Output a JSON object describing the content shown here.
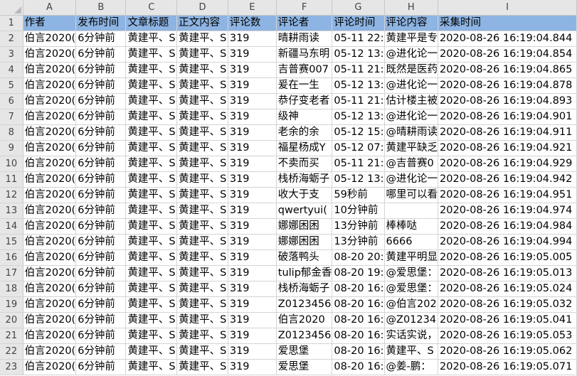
{
  "column_letters": [
    "A",
    "B",
    "C",
    "D",
    "E",
    "F",
    "G",
    "H",
    "I"
  ],
  "header_fill": "#8db4e2",
  "header": [
    "作者",
    "发布时间",
    "文章标题",
    "正文内容",
    "评论数",
    "评论者",
    "评论时间",
    "评论内容",
    "采集时间"
  ],
  "rows": [
    {
      "n": "2",
      "cells": [
        "伯言2020(",
        "6分钟前",
        "黄建平、S",
        "黄建平、S",
        "319",
        "晴耕雨读",
        "05-11 22:",
        "黄建平是专",
        "2020-08-26 16:19:04.844"
      ]
    },
    {
      "n": "3",
      "cells": [
        "伯言2020(",
        "6分钟前",
        "黄建平、S",
        "黄建平、S",
        "319",
        "新疆马东明",
        "05-12 13:",
        "@进化论一",
        "2020-08-26 16:19:04.854"
      ]
    },
    {
      "n": "4",
      "cells": [
        "伯言2020(",
        "6分钟前",
        "黄建平、S",
        "黄建平、S",
        "319",
        "吉普赛007",
        "05-11 21:",
        "既然是医药",
        "2020-08-26 16:19:04.865"
      ]
    },
    {
      "n": "5",
      "cells": [
        "伯言2020(",
        "6分钟前",
        "黄建平、S",
        "黄建平、S",
        "319",
        "爰在一生",
        "05-12 13:",
        "@进化论一",
        "2020-08-26 16:19:04.878"
      ]
    },
    {
      "n": "6",
      "cells": [
        "伯言2020(",
        "6分钟前",
        "黄建平、S",
        "黄建平、S",
        "319",
        "恭仔变老者",
        "05-11 21:",
        "估计楼主被",
        "2020-08-26 16:19:04.893"
      ]
    },
    {
      "n": "7",
      "cells": [
        "伯言2020(",
        "6分钟前",
        "黄建平、S",
        "黄建平、S",
        "319",
        "级神",
        "05-12 13:",
        "@进化论一",
        "2020-08-26 16:19:04.901"
      ]
    },
    {
      "n": "8",
      "cells": [
        "伯言2020(",
        "6分钟前",
        "黄建平、S",
        "黄建平、S",
        "319",
        "老余的余",
        "05-12 15:",
        "@晴耕雨读",
        "2020-08-26 16:19:04.911"
      ]
    },
    {
      "n": "9",
      "cells": [
        "伯言2020(",
        "6分钟前",
        "黄建平、S",
        "黄建平、S",
        "319",
        "福星杨成Y",
        "05-12 07:",
        "黄建平缺乏",
        "2020-08-26 16:19:04.921"
      ]
    },
    {
      "n": "10",
      "cells": [
        "伯言2020(",
        "6分钟前",
        "黄建平、S",
        "黄建平、S",
        "319",
        "不卖而买",
        "05-11 21:",
        "@吉普赛0",
        "2020-08-26 16:19:04.929"
      ]
    },
    {
      "n": "11",
      "cells": [
        "伯言2020(",
        "6分钟前",
        "黄建平、S",
        "黄建平、S",
        "319",
        "栈桥海蛎子",
        "05-12 13:",
        "@进化论一",
        "2020-08-26 16:19:04.942"
      ]
    },
    {
      "n": "12",
      "cells": [
        "伯言2020(",
        "6分钟前",
        "黄建平、S",
        "黄建平、S",
        "319",
        "收大于支",
        "59秒前",
        "哪里可以看",
        "2020-08-26 16:19:04.951"
      ]
    },
    {
      "n": "13",
      "cells": [
        "伯言2020(",
        "6分钟前",
        "黄建平、S",
        "黄建平、S",
        "319",
        "qwertyui(",
        "10分钟前",
        "",
        "2020-08-26 16:19:04.974"
      ]
    },
    {
      "n": "14",
      "cells": [
        "伯言2020(",
        "6分钟前",
        "黄建平、S",
        "黄建平、S",
        "319",
        "娜娜困困",
        "13分钟前",
        "棒棒哒",
        "2020-08-26 16:19:04.984"
      ]
    },
    {
      "n": "15",
      "cells": [
        "伯言2020(",
        "6分钟前",
        "黄建平、S",
        "黄建平、S",
        "319",
        "娜娜困困",
        "13分钟前",
        "6666",
        "2020-08-26 16:19:04.994"
      ]
    },
    {
      "n": "16",
      "cells": [
        "伯言2020(",
        "6分钟前",
        "黄建平、S",
        "黄建平、S",
        "319",
        "破落鸭头",
        "08-20 20:",
        "黄建平明显",
        "2020-08-26 16:19:05.005"
      ]
    },
    {
      "n": "17",
      "cells": [
        "伯言2020(",
        "6分钟前",
        "黄建平、S",
        "黄建平、S",
        "319",
        "tulip郁金香",
        "08-20 19:",
        "@爱思堡：",
        "2020-08-26 16:19:05.013"
      ]
    },
    {
      "n": "18",
      "cells": [
        "伯言2020(",
        "6分钟前",
        "黄建平、S",
        "黄建平、S",
        "319",
        "栈桥海蛎子",
        "08-20 16:",
        "@爱思堡：",
        "2020-08-26 16:19:05.024"
      ]
    },
    {
      "n": "19",
      "cells": [
        "伯言2020(",
        "6分钟前",
        "黄建平、S",
        "黄建平、S",
        "319",
        "Z0123456",
        "08-20 16:",
        "@伯言202",
        "2020-08-26 16:19:05.032"
      ]
    },
    {
      "n": "20",
      "cells": [
        "伯言2020(",
        "6分钟前",
        "黄建平、S",
        "黄建平、S",
        "319",
        "伯言2020",
        "08-20 16:",
        "@Z01234",
        "2020-08-26 16:19:05.041"
      ]
    },
    {
      "n": "21",
      "cells": [
        "伯言2020(",
        "6分钟前",
        "黄建平、S",
        "黄建平、S",
        "319",
        "Z0123456",
        "08-20 16:",
        "实话实说，",
        "2020-08-26 16:19:05.053"
      ]
    },
    {
      "n": "22",
      "cells": [
        "伯言2020(",
        "6分钟前",
        "黄建平、S",
        "黄建平、S",
        "319",
        "爱思堡",
        "08-20 16:",
        "黄建平、S",
        "2020-08-26 16:19:05.062"
      ]
    },
    {
      "n": "23",
      "cells": [
        "伯言2020(",
        "6分钟前",
        "黄建平、S",
        "黄建平、S",
        "319",
        "爱思堡",
        "08-20 16:",
        "@姜-鹏：",
        "2020-08-26 16:19:05.071"
      ]
    }
  ]
}
